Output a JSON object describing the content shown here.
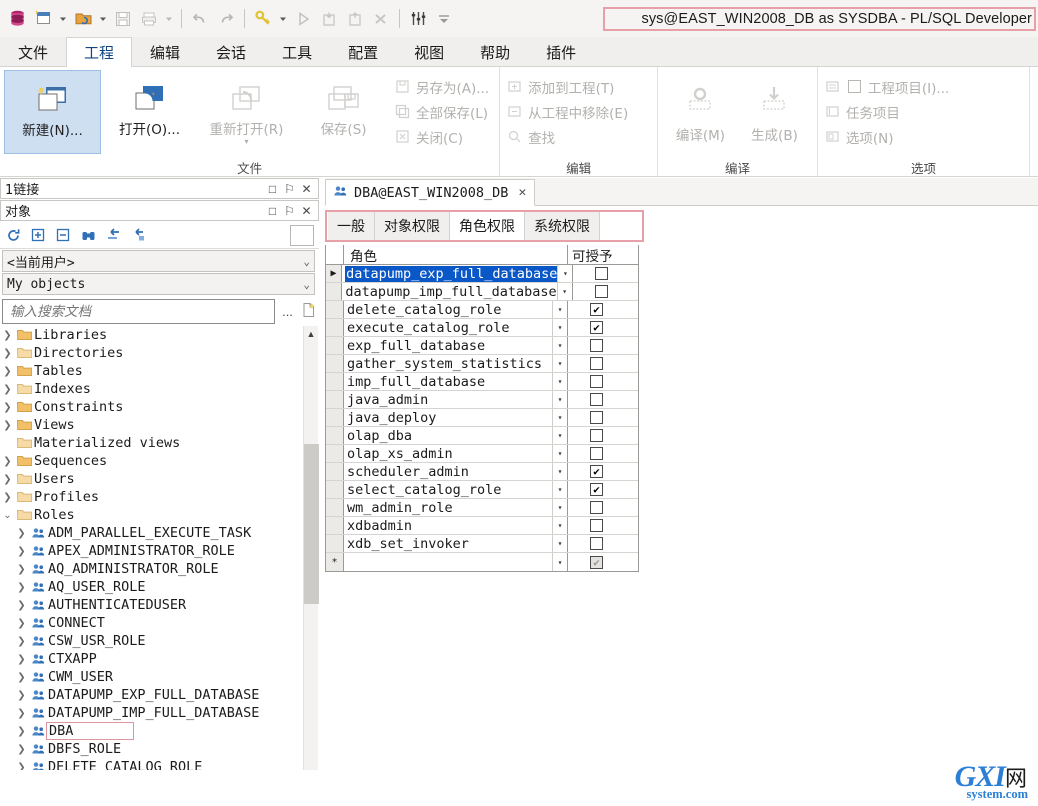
{
  "window": {
    "title": "sys@EAST_WIN2008_DB as SYSDBA - PL/SQL Developer",
    "highlight_color": "#e8a0a8"
  },
  "quick_access": [
    {
      "name": "database-icon",
      "glyph": "db"
    },
    {
      "name": "new-window-icon",
      "glyph": "new"
    },
    {
      "name": "new-dropdown-caret",
      "glyph": "▾"
    },
    {
      "name": "open-folder-icon",
      "glyph": "open"
    },
    {
      "name": "open-dropdown-caret",
      "glyph": "▾"
    },
    {
      "name": "save-icon",
      "glyph": "save"
    },
    {
      "name": "print-icon",
      "glyph": "print"
    },
    {
      "name": "print-dropdown-caret",
      "glyph": "▾"
    },
    {
      "name": "undo-icon",
      "glyph": "↺"
    },
    {
      "name": "redo-icon",
      "glyph": "↻"
    },
    {
      "name": "key-icon",
      "glyph": "key"
    },
    {
      "name": "key-dropdown-caret",
      "glyph": "▾"
    },
    {
      "name": "execute-icon",
      "glyph": "▶"
    },
    {
      "name": "commit-icon",
      "glyph": "commit"
    },
    {
      "name": "rollback-icon",
      "glyph": "rollback"
    },
    {
      "name": "break-icon",
      "glyph": "break"
    },
    {
      "name": "settings-sliders-icon",
      "glyph": "sliders"
    },
    {
      "name": "customize-caret-icon",
      "glyph": "▾"
    }
  ],
  "ribbon": {
    "tabs": [
      {
        "label": "文件",
        "active": false
      },
      {
        "label": "工程",
        "active": true
      },
      {
        "label": "编辑",
        "active": false
      },
      {
        "label": "会话",
        "active": false
      },
      {
        "label": "工具",
        "active": false
      },
      {
        "label": "配置",
        "active": false
      },
      {
        "label": "视图",
        "active": false
      },
      {
        "label": "帮助",
        "active": false
      },
      {
        "label": "插件",
        "active": false
      }
    ],
    "groups": [
      {
        "title": "文件",
        "big_buttons": [
          {
            "label": "新建(N)...",
            "selected": true,
            "disabled": false,
            "icon": "new-project-icon",
            "caret": false
          },
          {
            "label": "打开(O)...",
            "selected": false,
            "disabled": false,
            "icon": "open-project-icon",
            "caret": false
          },
          {
            "label": "重新打开(R)",
            "selected": false,
            "disabled": true,
            "icon": "reopen-icon",
            "caret": true
          },
          {
            "label": "保存(S)",
            "selected": false,
            "disabled": true,
            "icon": "save-project-icon",
            "caret": false
          }
        ],
        "small_buttons": [
          {
            "label": "另存为(A)...",
            "icon": "save-as-icon"
          },
          {
            "label": "全部保存(L)",
            "icon": "save-all-icon"
          },
          {
            "label": "关闭(C)",
            "icon": "close-file-icon"
          }
        ]
      },
      {
        "title": "编辑",
        "small_buttons": [
          {
            "label": "添加到工程(T)",
            "icon": "add-to-project-icon"
          },
          {
            "label": "从工程中移除(E)",
            "icon": "remove-from-project-icon"
          },
          {
            "label": "查找",
            "icon": "find-icon"
          }
        ]
      },
      {
        "title": "编译",
        "med_buttons": [
          {
            "label": "编译(M)",
            "icon": "compile-gear-icon"
          },
          {
            "label": "生成(B)",
            "icon": "build-arrow-icon"
          }
        ]
      },
      {
        "title": "选项",
        "small_buttons": [
          {
            "label": "工程项目(I)...",
            "icon": "project-items-icon",
            "checkbox": true
          },
          {
            "label": "任务项目",
            "icon": "task-items-icon",
            "checkbox": false
          },
          {
            "label": "选项(N)",
            "icon": "options-icon",
            "checkbox": false
          }
        ]
      }
    ]
  },
  "left_dock": {
    "connections_panel": {
      "title": "1链接",
      "buttons": [
        {
          "name": "maximize-icon",
          "glyph": "□"
        },
        {
          "name": "pin-icon",
          "glyph": "⚐"
        },
        {
          "name": "close-icon",
          "glyph": "✕"
        }
      ]
    },
    "objects_panel": {
      "title": "对象",
      "buttons": [
        {
          "name": "maximize-icon",
          "glyph": "□"
        },
        {
          "name": "pin-icon",
          "glyph": "⚐"
        },
        {
          "name": "close-icon",
          "glyph": "✕"
        }
      ],
      "toolbar": [
        {
          "name": "refresh-icon",
          "glyph": "⟳"
        },
        {
          "name": "expand-all-icon",
          "glyph": "⊞"
        },
        {
          "name": "collapse-all-icon",
          "glyph": "⊟"
        },
        {
          "name": "find-binoculars-icon",
          "glyph": "ὐd"
        },
        {
          "name": "filter-back-icon",
          "glyph": "↩"
        },
        {
          "name": "filter-lock-icon",
          "glyph": "↪"
        }
      ],
      "user_selector": "<当前用户>",
      "object_filter": "My objects",
      "search_placeholder": "输入搜索文档",
      "search_value": "",
      "search_more_label": "...",
      "search_new_icon": "new-filter-icon"
    },
    "tree": {
      "folders": [
        {
          "label": "Libraries",
          "expandable": true
        },
        {
          "label": "Directories",
          "expandable": true
        },
        {
          "label": "Tables",
          "expandable": true
        },
        {
          "label": "Indexes",
          "expandable": true
        },
        {
          "label": "Constraints",
          "expandable": true
        },
        {
          "label": "Views",
          "expandable": true
        },
        {
          "label": "Materialized views",
          "expandable": false
        },
        {
          "label": "Sequences",
          "expandable": true
        },
        {
          "label": "Users",
          "expandable": true
        },
        {
          "label": "Profiles",
          "expandable": true
        },
        {
          "label": "Roles",
          "expandable": true,
          "expanded": true
        }
      ],
      "roles": [
        {
          "label": "ADM_PARALLEL_EXECUTE_TASK",
          "highlighted": false
        },
        {
          "label": "APEX_ADMINISTRATOR_ROLE",
          "highlighted": false
        },
        {
          "label": "AQ_ADMINISTRATOR_ROLE",
          "highlighted": false
        },
        {
          "label": "AQ_USER_ROLE",
          "highlighted": false
        },
        {
          "label": "AUTHENTICATEDUSER",
          "highlighted": false
        },
        {
          "label": "CONNECT",
          "highlighted": false
        },
        {
          "label": "CSW_USR_ROLE",
          "highlighted": false
        },
        {
          "label": "CTXAPP",
          "highlighted": false
        },
        {
          "label": "CWM_USER",
          "highlighted": false
        },
        {
          "label": "DATAPUMP_EXP_FULL_DATABASE",
          "highlighted": false
        },
        {
          "label": "DATAPUMP_IMP_FULL_DATABASE",
          "highlighted": false
        },
        {
          "label": "DBA",
          "highlighted": true
        },
        {
          "label": "DBFS_ROLE",
          "highlighted": false
        },
        {
          "label": "DELETE_CATALOG_ROLE",
          "highlighted": false
        }
      ]
    }
  },
  "main": {
    "doc_tab": {
      "label": "DBA@EAST_WIN2008_DB",
      "icon": "role-icon",
      "close": "✕"
    },
    "sub_tabs": [
      {
        "label": "一般",
        "active": false
      },
      {
        "label": "对象权限",
        "active": false
      },
      {
        "label": "角色权限",
        "active": true
      },
      {
        "label": "系统权限",
        "active": false
      }
    ],
    "grid": {
      "columns": [
        "角色",
        "可授予"
      ],
      "rows": [
        {
          "role": "datapump_exp_full_database",
          "grantable": false,
          "selected": true
        },
        {
          "role": "datapump_imp_full_database",
          "grantable": false,
          "selected": false
        },
        {
          "role": "delete_catalog_role",
          "grantable": true,
          "selected": false
        },
        {
          "role": "execute_catalog_role",
          "grantable": true,
          "selected": false
        },
        {
          "role": "exp_full_database",
          "grantable": false,
          "selected": false
        },
        {
          "role": "gather_system_statistics",
          "grantable": false,
          "selected": false
        },
        {
          "role": "imp_full_database",
          "grantable": false,
          "selected": false
        },
        {
          "role": "java_admin",
          "grantable": false,
          "selected": false
        },
        {
          "role": "java_deploy",
          "grantable": false,
          "selected": false
        },
        {
          "role": "olap_dba",
          "grantable": false,
          "selected": false
        },
        {
          "role": "olap_xs_admin",
          "grantable": false,
          "selected": false
        },
        {
          "role": "scheduler_admin",
          "grantable": true,
          "selected": false
        },
        {
          "role": "select_catalog_role",
          "grantable": true,
          "selected": false
        },
        {
          "role": "wm_admin_role",
          "grantable": false,
          "selected": false
        },
        {
          "role": "xdbadmin",
          "grantable": false,
          "selected": false
        },
        {
          "role": "xdb_set_invoker",
          "grantable": false,
          "selected": false
        }
      ],
      "new_row": {
        "indicator": "*",
        "role": "",
        "grantable_grayed": true
      },
      "selected_indicator": "▶",
      "row_caret": "▾",
      "check_glyph": "✔"
    }
  },
  "watermark": {
    "main": "GXI",
    "cn": "网",
    "sub": "system.com"
  }
}
